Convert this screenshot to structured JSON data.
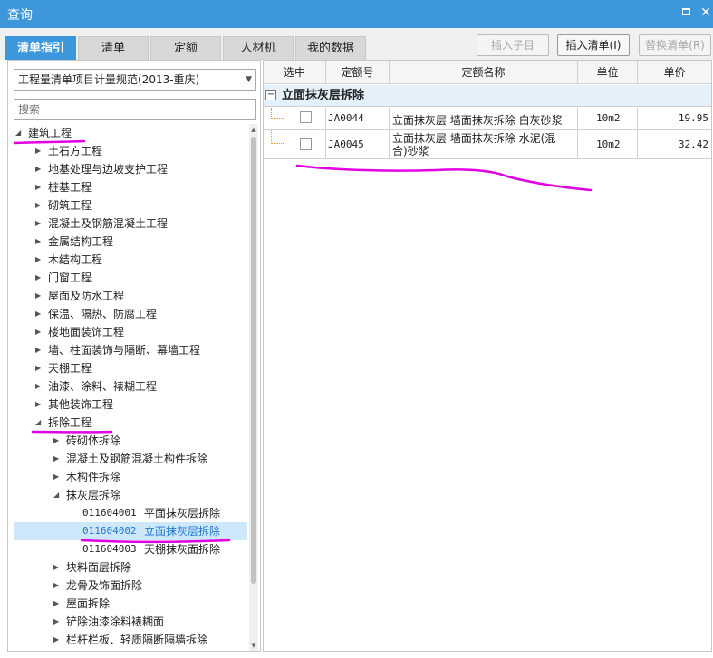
{
  "window": {
    "title": "查询",
    "restore_icon": "restore-icon",
    "close_icon": "close-icon"
  },
  "tabs": [
    {
      "label": "清单指引",
      "active": true
    },
    {
      "label": "清单"
    },
    {
      "label": "定额"
    },
    {
      "label": "人材机"
    },
    {
      "label": "我的数据"
    }
  ],
  "toolbar": {
    "insert_child": "插入子目",
    "insert_list": "插入清单(I)",
    "replace_list": "替换清单(R)"
  },
  "left": {
    "spec_select": "工程量清单项目计量规范(2013-重庆)",
    "search_placeholder": "搜索",
    "tree": [
      {
        "label": "建筑工程",
        "level": 0,
        "expanded": true
      },
      {
        "label": "土石方工程",
        "level": 1
      },
      {
        "label": "地基处理与边坡支护工程",
        "level": 1
      },
      {
        "label": "桩基工程",
        "level": 1
      },
      {
        "label": "砌筑工程",
        "level": 1
      },
      {
        "label": "混凝土及钢筋混凝土工程",
        "level": 1
      },
      {
        "label": "金属结构工程",
        "level": 1
      },
      {
        "label": "木结构工程",
        "level": 1
      },
      {
        "label": "门窗工程",
        "level": 1
      },
      {
        "label": "屋面及防水工程",
        "level": 1
      },
      {
        "label": "保温、隔热、防腐工程",
        "level": 1
      },
      {
        "label": "楼地面装饰工程",
        "level": 1
      },
      {
        "label": "墙、柱面装饰与隔断、幕墙工程",
        "level": 1
      },
      {
        "label": "天棚工程",
        "level": 1
      },
      {
        "label": "油漆、涂料、裱糊工程",
        "level": 1
      },
      {
        "label": "其他装饰工程",
        "level": 1
      },
      {
        "label": "拆除工程",
        "level": 1,
        "expanded": true
      },
      {
        "label": "砖砌体拆除",
        "level": 2
      },
      {
        "label": "混凝土及钢筋混凝土构件拆除",
        "level": 2
      },
      {
        "label": "木构件拆除",
        "level": 2
      },
      {
        "label": "抹灰层拆除",
        "level": 2,
        "expanded": true
      },
      {
        "code": "011604001",
        "label": "平面抹灰层拆除",
        "level": 3
      },
      {
        "code": "011604002",
        "label": "立面抹灰层拆除",
        "level": 3,
        "selected": true
      },
      {
        "code": "011604003",
        "label": "天棚抹灰面拆除",
        "level": 3
      },
      {
        "label": "块料面层拆除",
        "level": 2
      },
      {
        "label": "龙骨及饰面拆除",
        "level": 2
      },
      {
        "label": "屋面拆除",
        "level": 2
      },
      {
        "label": "铲除油漆涂料裱糊面",
        "level": 2
      },
      {
        "label": "栏杆栏板、轻质隔断隔墙拆除",
        "level": 2
      }
    ]
  },
  "grid": {
    "columns": [
      "选中",
      "定额号",
      "定额名称",
      "单位",
      "单价"
    ],
    "group_title": "立面抹灰层拆除",
    "rows": [
      {
        "code": "JA0044",
        "name": "立面抹灰层 墙面抹灰拆除 白灰砂浆",
        "unit": "10m2",
        "price": "19.95",
        "checked": false
      },
      {
        "code": "JA0045",
        "name": "立面抹灰层 墙面抹灰拆除 水泥(混合)砂浆",
        "unit": "10m2",
        "price": "32.42",
        "checked": false
      }
    ]
  },
  "colors": {
    "accent": "#3f97db",
    "selected_bg": "#cde8fb",
    "annotation": "#e000e0"
  }
}
